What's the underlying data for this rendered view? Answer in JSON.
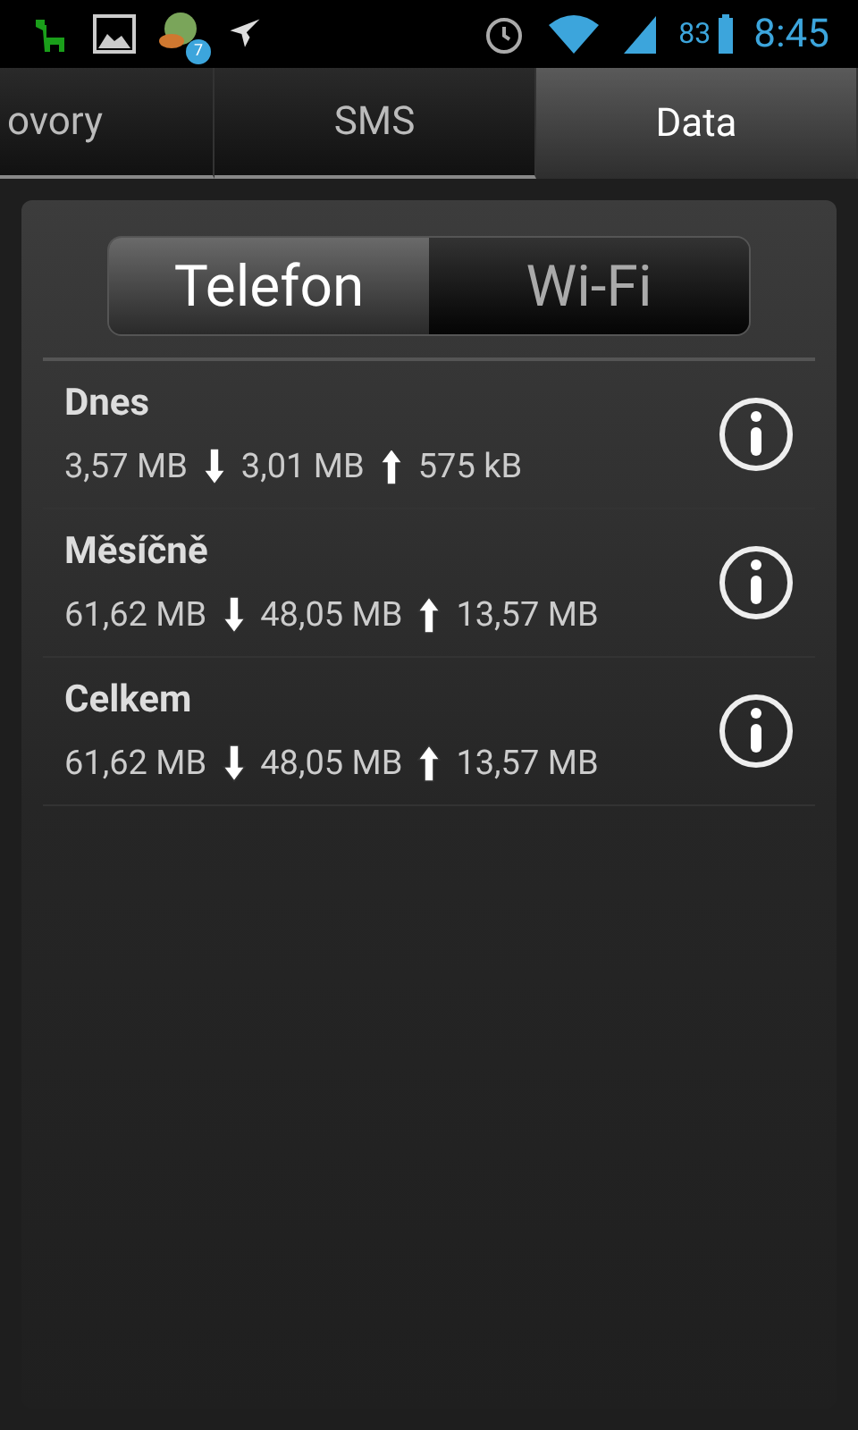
{
  "status_bar": {
    "notification_badge": "7",
    "battery_percent": "83",
    "time": "8:45"
  },
  "tabs": [
    {
      "label": "ovory",
      "selected": false
    },
    {
      "label": "SMS",
      "selected": false
    },
    {
      "label": "Data",
      "selected": true
    }
  ],
  "segments": [
    {
      "label": "Telefon",
      "selected": true
    },
    {
      "label": "Wi-Fi",
      "selected": false
    }
  ],
  "rows": [
    {
      "title": "Dnes",
      "total": "3,57 MB",
      "download": "3,01 MB",
      "upload": "575 kB"
    },
    {
      "title": "Měsíčně",
      "total": "61,62 MB",
      "download": "48,05 MB",
      "upload": "13,57 MB"
    },
    {
      "title": "Celkem",
      "total": "61,62 MB",
      "download": "48,05 MB",
      "upload": "13,57 MB"
    }
  ]
}
